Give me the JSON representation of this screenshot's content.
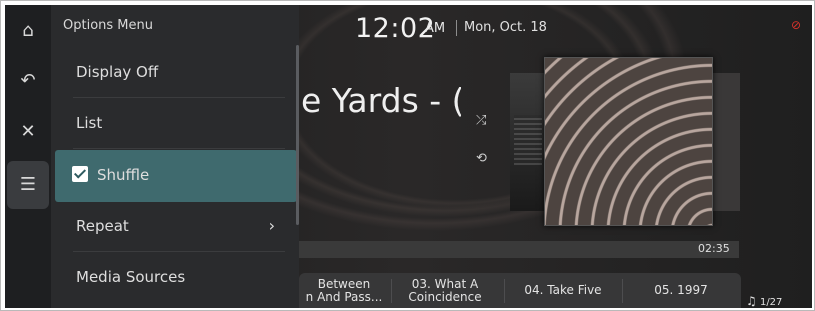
{
  "status": {
    "time": "12:02",
    "ampm": "AM",
    "date": "Mon, Oct. 18",
    "status_icon": "⊘"
  },
  "rail": {
    "icons": [
      "home-icon",
      "back-icon",
      "close-icon",
      "playlist-icon"
    ]
  },
  "menu": {
    "title": "Options Menu",
    "items": [
      {
        "label": "Display Off",
        "checked": null,
        "has_submenu": false
      },
      {
        "label": "List",
        "checked": null,
        "has_submenu": false
      },
      {
        "label": "Shuffle",
        "checked": true,
        "has_submenu": false
      },
      {
        "label": "Repeat",
        "checked": null,
        "has_submenu": true
      },
      {
        "label": "Media Sources",
        "checked": null,
        "has_submenu": false
      }
    ]
  },
  "player": {
    "song_title": "e Yards - (",
    "duration": "02:35",
    "track_count": "1/27",
    "playlist": [
      {
        "line1": "Between",
        "line2": "n And Pass..."
      },
      {
        "line1": "03. What A",
        "line2": "Coincidence"
      },
      {
        "line1": "04. Take Five",
        "line2": ""
      },
      {
        "line1": "05. 1997",
        "line2": ""
      }
    ]
  },
  "colors": {
    "selected_item": "#3f6a6e",
    "accent_red": "#d8332b"
  }
}
